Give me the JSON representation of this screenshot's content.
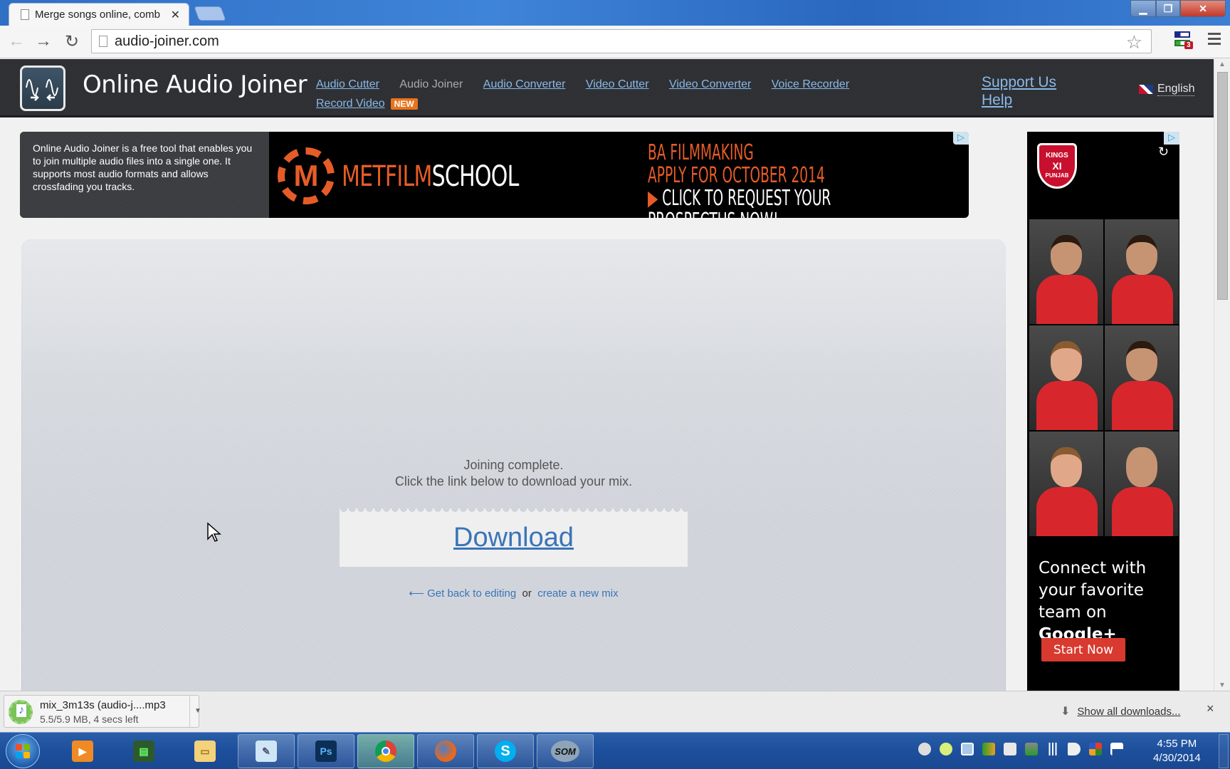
{
  "browser": {
    "tab_title": "Merge songs online, comb",
    "url": "audio-joiner.com",
    "extension_badge": "3"
  },
  "site": {
    "brand": "Online Audio Joiner",
    "nav": [
      {
        "label": "Audio Cutter",
        "current": false
      },
      {
        "label": "Audio Joiner",
        "current": true
      },
      {
        "label": "Audio Converter",
        "current": false
      },
      {
        "label": "Video Cutter",
        "current": false
      },
      {
        "label": "Video Converter",
        "current": false
      },
      {
        "label": "Voice Recorder",
        "current": false
      },
      {
        "label": "Record Video",
        "current": false
      }
    ],
    "new_badge": "NEW",
    "support_us": "Support Us",
    "help": "Help",
    "language": "English",
    "accent_color": "#8ab8e8"
  },
  "top_ad": {
    "description": "Online Audio Joiner is a free tool that enables you to join multiple audio files into a single one. It supports most audio formats and allows crossfading you tracks.",
    "logo_letter": "M",
    "brand_orange": "METFILM",
    "brand_white": "SCHOOL",
    "line1": "BA FILMMAKING",
    "line2": "APPLY FOR OCTOBER 2014",
    "line3": "CLICK TO REQUEST YOUR PROSPECTUS NOW!",
    "ad_choices": "▷"
  },
  "main": {
    "status_line1": "Joining complete.",
    "status_line2": "Click the link below to download your mix.",
    "download_label": "Download",
    "back_arrow": "⟵",
    "back_link": "Get back to editing",
    "or_text": "or",
    "new_mix_link": "create a new mix"
  },
  "right_ad": {
    "team_logo_top": "KINGS",
    "team_logo_mid": "XI",
    "team_logo_bot": "PUNJAB",
    "refresh_icon": "↻",
    "players_count": 6,
    "text_line1": "Connect with",
    "text_line2": "your favorite",
    "text_line3_a": "team on ",
    "text_line3_b": "Google+",
    "cta": "Start Now",
    "gplus_glyph": "g"
  },
  "downloads": {
    "filename": "mix_3m13s (audio-j....mp3",
    "status": "5.5/5.9 MB, 4 secs left",
    "progress_fraction": 0.93,
    "show_all": "Show all downloads...",
    "close": "×"
  },
  "taskbar": {
    "apps": [
      "Windows Media Player",
      "Task Manager",
      "Windows Explorer",
      "Notepad",
      "Photoshop",
      "Chrome",
      "Firefox",
      "Skype",
      "SOM"
    ],
    "ps_label": "Ps",
    "som_label": "SOM",
    "time": "4:55 PM",
    "date": "4/30/2014"
  }
}
